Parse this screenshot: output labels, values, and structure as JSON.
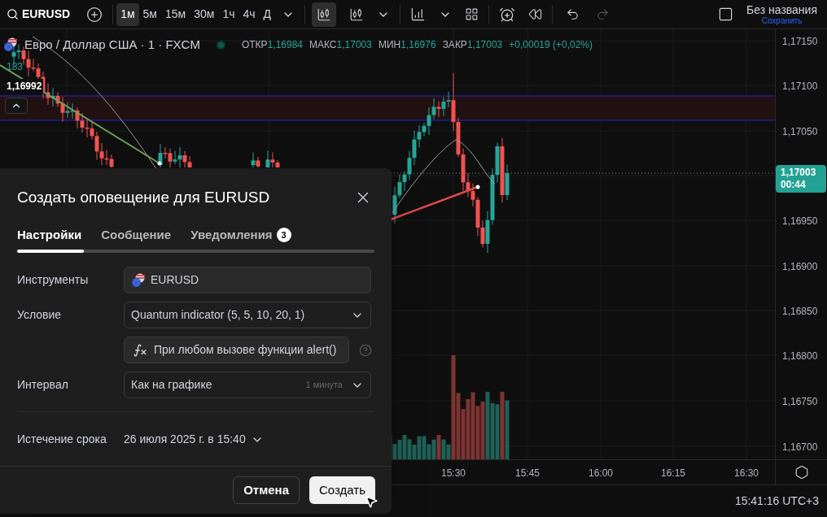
{
  "toolbar": {
    "symbol": "EURUSD",
    "intervals": [
      {
        "label": "1м",
        "selected": true
      },
      {
        "label": "5м",
        "selected": false
      },
      {
        "label": "15м",
        "selected": false
      },
      {
        "label": "30м",
        "selected": false
      },
      {
        "label": "1ч",
        "selected": false
      },
      {
        "label": "4ч",
        "selected": false
      },
      {
        "label": "Д",
        "selected": false
      }
    ],
    "layout_name": "Без названия",
    "save_label": "Сохранить"
  },
  "legend": {
    "title": "Евро / Доллар США · 1 · FXCM",
    "values": [
      {
        "label": "ОТКР",
        "value": "1,16984"
      },
      {
        "label": "МАКС",
        "value": "1,17003"
      },
      {
        "label": "МИН",
        "value": "1,16976"
      },
      {
        "label": "ЗАКР",
        "value": "1,17003"
      }
    ],
    "change": "+0,00019 (+0,02%)"
  },
  "chart": {
    "volume_label": "183",
    "crosshair_price": "1,16992",
    "price_ticks": [
      "1,17150",
      "1,17100",
      "1,17050",
      "1,16950",
      "1,16900",
      "1,16850",
      "1,16800",
      "1,16750",
      "1,16700"
    ],
    "last_price": "1,17003",
    "countdown": "00:44",
    "time_ticks": [
      "15:30",
      "15:45",
      "16:00",
      "16:15",
      "16:30"
    ]
  },
  "status_bar": {
    "clock": "15:41:16 UTC+3"
  },
  "dialog": {
    "title": "Создать оповещение для EURUSD",
    "tabs": [
      {
        "label": "Настройки",
        "selected": true
      },
      {
        "label": "Сообщение",
        "selected": false
      },
      {
        "label": "Уведомления",
        "selected": false,
        "badge": "3"
      }
    ],
    "fields": [
      {
        "kind": "symbol",
        "label": "Инструменты",
        "value": "EURUSD"
      },
      {
        "kind": "select",
        "label": "Условие",
        "value": "Quantum indicator (5, 5, 10, 20, 1)"
      },
      {
        "kind": "function",
        "value": "При любом вызове функции alert()"
      },
      {
        "kind": "select",
        "label": "Интервал",
        "value": "Как на графике",
        "hint": "1 минута"
      }
    ],
    "expiration": {
      "label": "Истечение срока",
      "value": "26 июля 2025 г. в 15:40"
    },
    "buttons": [
      {
        "label": "Отмена",
        "kind": "secondary"
      },
      {
        "label": "Создать",
        "kind": "primary"
      }
    ]
  }
}
